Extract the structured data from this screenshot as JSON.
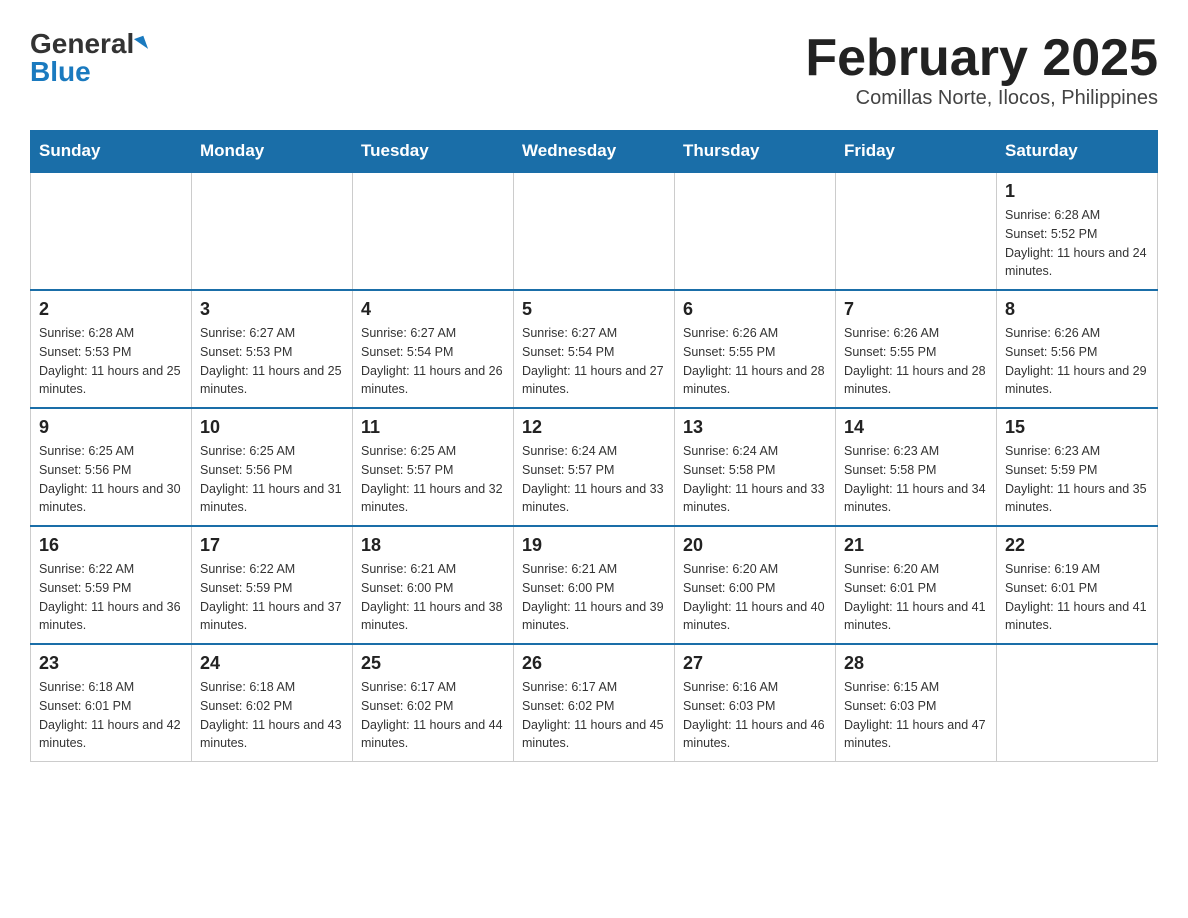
{
  "header": {
    "logo_general": "General",
    "logo_blue": "Blue",
    "title": "February 2025",
    "subtitle": "Comillas Norte, Ilocos, Philippines"
  },
  "days_of_week": [
    "Sunday",
    "Monday",
    "Tuesday",
    "Wednesday",
    "Thursday",
    "Friday",
    "Saturday"
  ],
  "weeks": [
    [
      {
        "day": "",
        "info": ""
      },
      {
        "day": "",
        "info": ""
      },
      {
        "day": "",
        "info": ""
      },
      {
        "day": "",
        "info": ""
      },
      {
        "day": "",
        "info": ""
      },
      {
        "day": "",
        "info": ""
      },
      {
        "day": "1",
        "info": "Sunrise: 6:28 AM\nSunset: 5:52 PM\nDaylight: 11 hours and 24 minutes."
      }
    ],
    [
      {
        "day": "2",
        "info": "Sunrise: 6:28 AM\nSunset: 5:53 PM\nDaylight: 11 hours and 25 minutes."
      },
      {
        "day": "3",
        "info": "Sunrise: 6:27 AM\nSunset: 5:53 PM\nDaylight: 11 hours and 25 minutes."
      },
      {
        "day": "4",
        "info": "Sunrise: 6:27 AM\nSunset: 5:54 PM\nDaylight: 11 hours and 26 minutes."
      },
      {
        "day": "5",
        "info": "Sunrise: 6:27 AM\nSunset: 5:54 PM\nDaylight: 11 hours and 27 minutes."
      },
      {
        "day": "6",
        "info": "Sunrise: 6:26 AM\nSunset: 5:55 PM\nDaylight: 11 hours and 28 minutes."
      },
      {
        "day": "7",
        "info": "Sunrise: 6:26 AM\nSunset: 5:55 PM\nDaylight: 11 hours and 28 minutes."
      },
      {
        "day": "8",
        "info": "Sunrise: 6:26 AM\nSunset: 5:56 PM\nDaylight: 11 hours and 29 minutes."
      }
    ],
    [
      {
        "day": "9",
        "info": "Sunrise: 6:25 AM\nSunset: 5:56 PM\nDaylight: 11 hours and 30 minutes."
      },
      {
        "day": "10",
        "info": "Sunrise: 6:25 AM\nSunset: 5:56 PM\nDaylight: 11 hours and 31 minutes."
      },
      {
        "day": "11",
        "info": "Sunrise: 6:25 AM\nSunset: 5:57 PM\nDaylight: 11 hours and 32 minutes."
      },
      {
        "day": "12",
        "info": "Sunrise: 6:24 AM\nSunset: 5:57 PM\nDaylight: 11 hours and 33 minutes."
      },
      {
        "day": "13",
        "info": "Sunrise: 6:24 AM\nSunset: 5:58 PM\nDaylight: 11 hours and 33 minutes."
      },
      {
        "day": "14",
        "info": "Sunrise: 6:23 AM\nSunset: 5:58 PM\nDaylight: 11 hours and 34 minutes."
      },
      {
        "day": "15",
        "info": "Sunrise: 6:23 AM\nSunset: 5:59 PM\nDaylight: 11 hours and 35 minutes."
      }
    ],
    [
      {
        "day": "16",
        "info": "Sunrise: 6:22 AM\nSunset: 5:59 PM\nDaylight: 11 hours and 36 minutes."
      },
      {
        "day": "17",
        "info": "Sunrise: 6:22 AM\nSunset: 5:59 PM\nDaylight: 11 hours and 37 minutes."
      },
      {
        "day": "18",
        "info": "Sunrise: 6:21 AM\nSunset: 6:00 PM\nDaylight: 11 hours and 38 minutes."
      },
      {
        "day": "19",
        "info": "Sunrise: 6:21 AM\nSunset: 6:00 PM\nDaylight: 11 hours and 39 minutes."
      },
      {
        "day": "20",
        "info": "Sunrise: 6:20 AM\nSunset: 6:00 PM\nDaylight: 11 hours and 40 minutes."
      },
      {
        "day": "21",
        "info": "Sunrise: 6:20 AM\nSunset: 6:01 PM\nDaylight: 11 hours and 41 minutes."
      },
      {
        "day": "22",
        "info": "Sunrise: 6:19 AM\nSunset: 6:01 PM\nDaylight: 11 hours and 41 minutes."
      }
    ],
    [
      {
        "day": "23",
        "info": "Sunrise: 6:18 AM\nSunset: 6:01 PM\nDaylight: 11 hours and 42 minutes."
      },
      {
        "day": "24",
        "info": "Sunrise: 6:18 AM\nSunset: 6:02 PM\nDaylight: 11 hours and 43 minutes."
      },
      {
        "day": "25",
        "info": "Sunrise: 6:17 AM\nSunset: 6:02 PM\nDaylight: 11 hours and 44 minutes."
      },
      {
        "day": "26",
        "info": "Sunrise: 6:17 AM\nSunset: 6:02 PM\nDaylight: 11 hours and 45 minutes."
      },
      {
        "day": "27",
        "info": "Sunrise: 6:16 AM\nSunset: 6:03 PM\nDaylight: 11 hours and 46 minutes."
      },
      {
        "day": "28",
        "info": "Sunrise: 6:15 AM\nSunset: 6:03 PM\nDaylight: 11 hours and 47 minutes."
      },
      {
        "day": "",
        "info": ""
      }
    ]
  ]
}
